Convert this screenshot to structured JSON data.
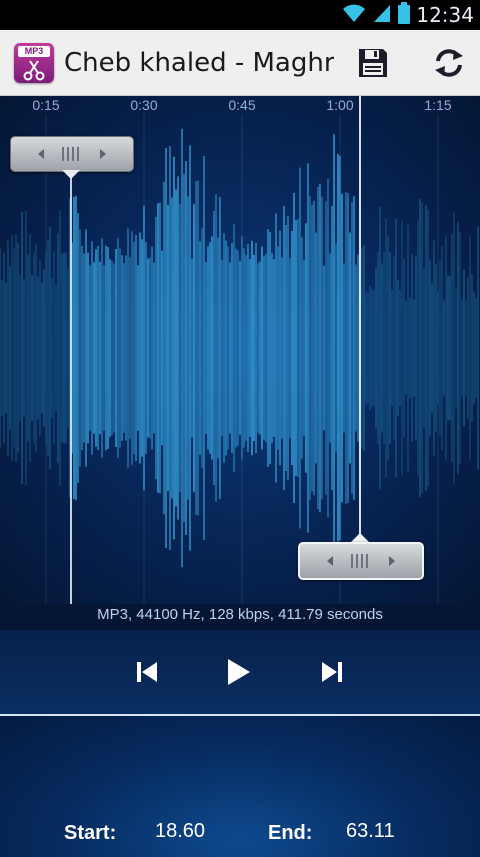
{
  "status_bar": {
    "time": "12:34",
    "icons": [
      "wifi-icon",
      "signal-icon",
      "battery-icon"
    ]
  },
  "action_bar": {
    "app_icon_tag": "MP3",
    "title": "Cheb khaled - Maghre...",
    "save_icon": "floppy-disk-icon",
    "refresh_icon": "refresh-icon"
  },
  "timeline": {
    "labels": [
      "0:15",
      "0:30",
      "0:45",
      "1:00",
      "1:15"
    ]
  },
  "file_info": "MP3, 44100 Hz, 128 kbps, 411.79 seconds",
  "playback": {
    "previous_icon": "skip-previous-icon",
    "play_icon": "play-icon",
    "next_icon": "skip-next-icon"
  },
  "selection": {
    "start_label": "Start:",
    "start_value": "18.60",
    "end_label": "End:",
    "end_value": "63.11"
  },
  "colors": {
    "accent_wave": "#3fb6f2",
    "wave_dim": "#1f6f9e",
    "background": "#041634",
    "action_bar": "#efefef"
  }
}
